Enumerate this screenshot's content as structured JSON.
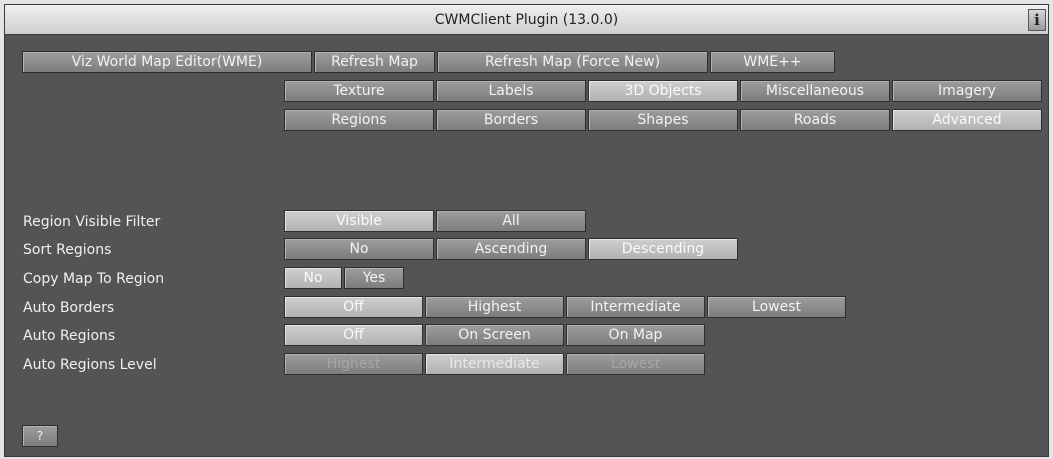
{
  "window": {
    "title": "CWMClient Plugin (13.0.0)",
    "info_icon": "i"
  },
  "toolbar": {
    "wme_editor": "Viz World Map Editor(WME)",
    "refresh_map": "Refresh Map",
    "refresh_force": "Refresh Map (Force New)",
    "wme_plus": "WME++"
  },
  "tabs": {
    "texture": "Texture",
    "labels": "Labels",
    "objects3d": "3D Objects",
    "miscellaneous": "Miscellaneous",
    "imagery": "Imagery",
    "regions": "Regions",
    "borders": "Borders",
    "shapes": "Shapes",
    "roads": "Roads",
    "advanced": "Advanced",
    "selected": "Advanced"
  },
  "settings": {
    "region_visible_filter": {
      "label": "Region Visible Filter",
      "options": [
        "Visible",
        "All"
      ],
      "selected": "Visible"
    },
    "sort_regions": {
      "label": "Sort Regions",
      "options": [
        "No",
        "Ascending",
        "Descending"
      ],
      "selected": "Descending"
    },
    "copy_map_to_region": {
      "label": "Copy Map To Region",
      "options": [
        "No",
        "Yes"
      ],
      "selected": "No"
    },
    "auto_borders": {
      "label": "Auto Borders",
      "options": [
        "Off",
        "Highest",
        "Intermediate",
        "Lowest"
      ],
      "selected": "Off"
    },
    "auto_regions": {
      "label": "Auto Regions",
      "options": [
        "Off",
        "On Screen",
        "On Map"
      ],
      "selected": "Off"
    },
    "auto_regions_level": {
      "label": "Auto Regions Level",
      "options": [
        "Highest",
        "Intermediate",
        "Lowest"
      ],
      "selected": "Intermediate",
      "disabled": true
    }
  },
  "help": {
    "label": "?"
  }
}
